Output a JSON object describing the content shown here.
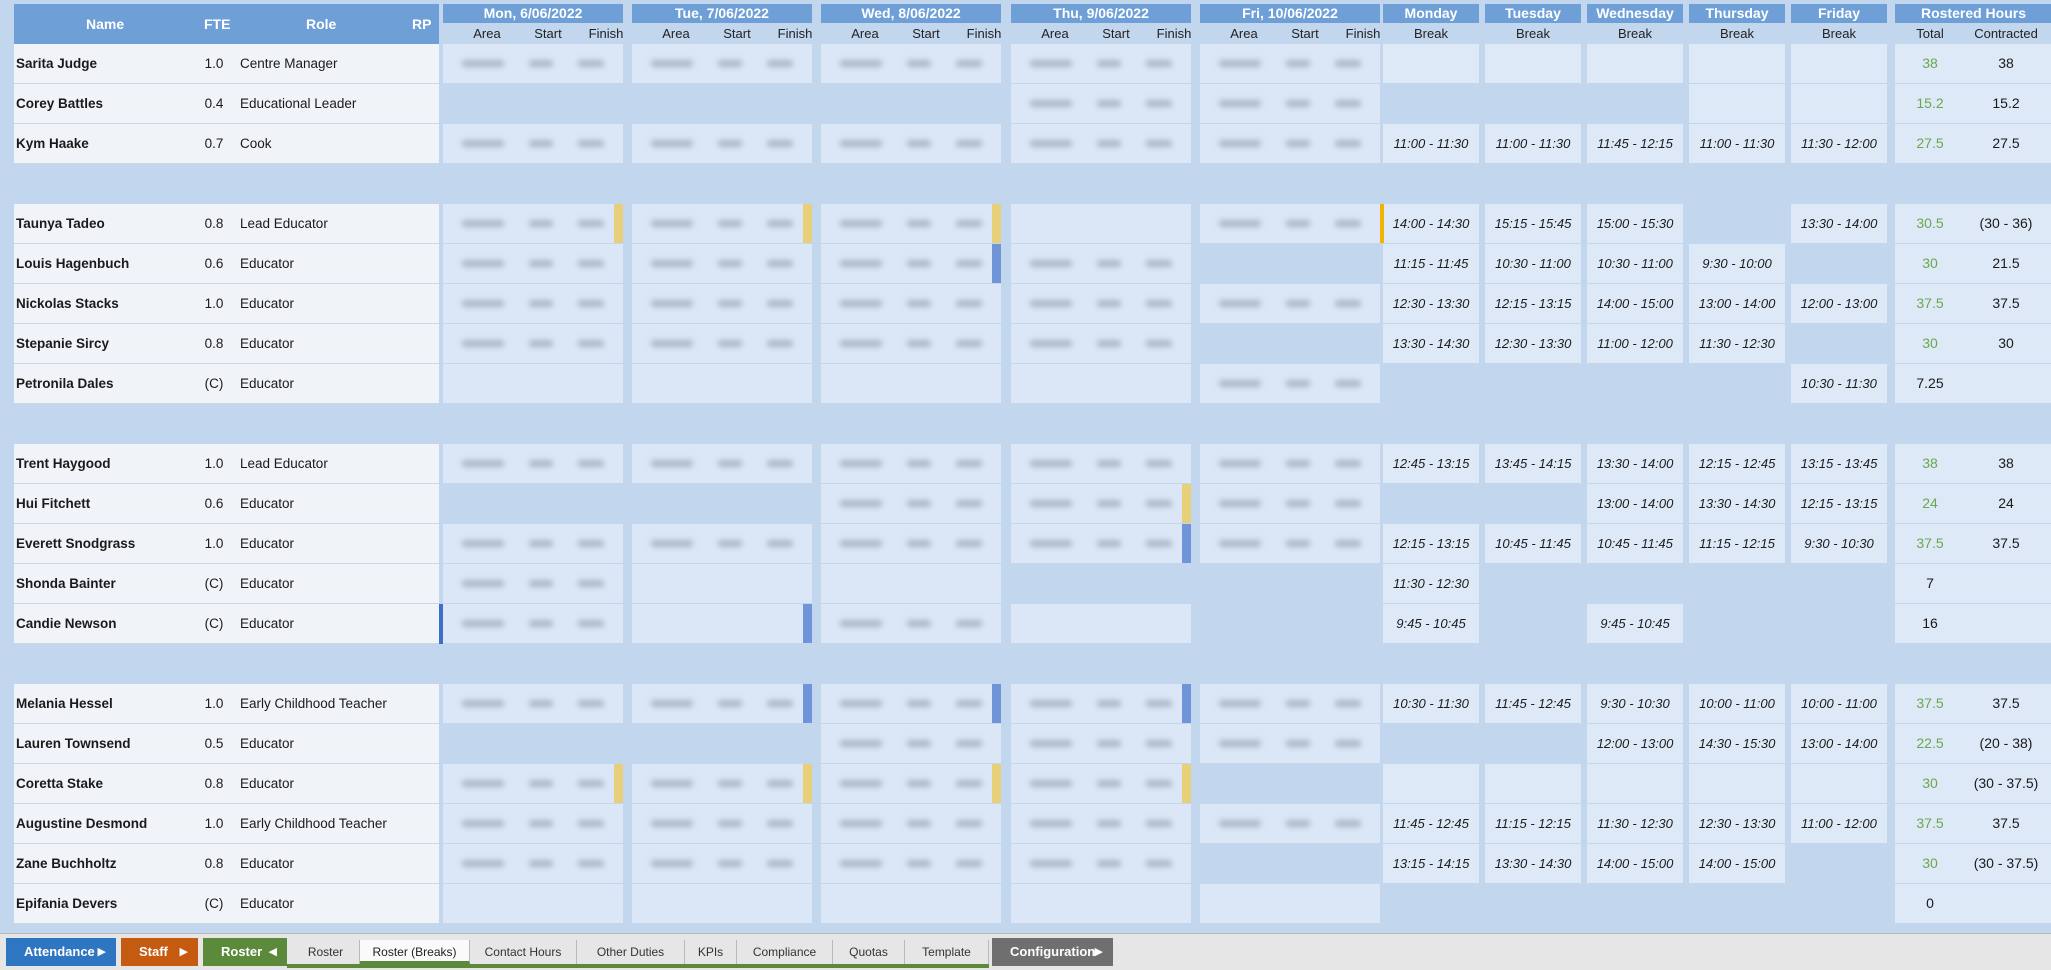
{
  "columns": {
    "name": "Name",
    "fte": "FTE",
    "role": "Role",
    "rp": "RP",
    "area": "Area",
    "start": "Start",
    "finish": "Finish",
    "break": "Break",
    "total": "Total",
    "contracted": "Contracted",
    "rostered_hours": "Rostered Hours"
  },
  "days": [
    "Mon, 6/06/2022",
    "Tue, 7/06/2022",
    "Wed, 8/06/2022",
    "Thu, 9/06/2022",
    "Fri, 10/06/2022"
  ],
  "break_days": [
    "Monday",
    "Tuesday",
    "Wednesday",
    "Thursday",
    "Friday"
  ],
  "staff": [
    {
      "name": "Sarita Judge",
      "fte": "1.0",
      "role": "Centre Manager",
      "shifts": [
        1,
        1,
        1,
        1,
        1
      ],
      "flags": [
        "",
        "",
        "",
        "",
        ""
      ],
      "breaks": [
        "",
        "",
        "",
        "",
        ""
      ],
      "total": "38",
      "contracted": "38",
      "green": true
    },
    {
      "name": "Corey Battles",
      "fte": "0.4",
      "role": "Educational Leader",
      "shifts": [
        0,
        0,
        0,
        1,
        1
      ],
      "flags": [
        "",
        "",
        "",
        "",
        ""
      ],
      "breaks": [
        null,
        null,
        null,
        "",
        ""
      ],
      "total": "15.2",
      "contracted": "15.2",
      "green": true
    },
    {
      "name": "Kym Haake",
      "fte": "0.7",
      "role": "Cook",
      "shifts": [
        1,
        1,
        1,
        1,
        1
      ],
      "flags": [
        "",
        "",
        "",
        "",
        ""
      ],
      "breaks": [
        "11:00  -  11:30",
        "11:00  -  11:30",
        "11:45  -  12:15",
        "11:00  -  11:30",
        "11:30  -  12:00"
      ],
      "total": "27.5",
      "contracted": "27.5",
      "green": true
    },
    {
      "spacer": true
    },
    {
      "name": "Taunya Tadeo",
      "fte": "0.8",
      "role": "Lead Educator",
      "shifts": [
        1,
        1,
        1,
        2,
        1
      ],
      "flags": [
        "#e8cf7a",
        "#e8cf7a",
        "#e8cf7a",
        "",
        ""
      ],
      "breaks": [
        "14:00  -  14:30",
        "15:15  -  15:45",
        "15:00  -  15:30",
        null,
        "13:30  -  14:00"
      ],
      "total": "30.5",
      "contracted": "(30 - 36)",
      "green": true,
      "mark": true
    },
    {
      "name": "Louis Hagenbuch",
      "fte": "0.6",
      "role": "Educator",
      "shifts": [
        1,
        1,
        1,
        1,
        0
      ],
      "flags": [
        "",
        "",
        "#6f95d8",
        "",
        ""
      ],
      "breaks": [
        "11:15  -  11:45",
        "10:30  -  11:00",
        "10:30  -  11:00",
        "9:30  -  10:00",
        null
      ],
      "total": "30",
      "contracted": "21.5",
      "green": true
    },
    {
      "name": "Nickolas Stacks",
      "fte": "1.0",
      "role": "Educator",
      "shifts": [
        1,
        1,
        1,
        1,
        1
      ],
      "flags": [
        "",
        "",
        "",
        "",
        ""
      ],
      "breaks": [
        "12:30  -  13:30",
        "12:15  -  13:15",
        "14:00  -  15:00",
        "13:00  -  14:00",
        "12:00  -  13:00"
      ],
      "total": "37.5",
      "contracted": "37.5",
      "green": true
    },
    {
      "name": "Stepanie Sircy",
      "fte": "0.8",
      "role": "Educator",
      "shifts": [
        1,
        1,
        1,
        1,
        0
      ],
      "flags": [
        "",
        "",
        "",
        "",
        ""
      ],
      "breaks": [
        "13:30  -  14:30",
        "12:30  -  13:30",
        "11:00  -  12:00",
        "11:30  -  12:30",
        null
      ],
      "total": "30",
      "contracted": "30",
      "green": true
    },
    {
      "name": "Petronila Dales",
      "fte": "(C)",
      "role": "Educator",
      "shifts": [
        2,
        2,
        2,
        2,
        1
      ],
      "flags": [
        "",
        "",
        "",
        "",
        ""
      ],
      "breaks": [
        null,
        null,
        null,
        null,
        "10:30  -  11:30"
      ],
      "total": "7.25",
      "contracted": "",
      "green": false
    },
    {
      "spacer": true
    },
    {
      "name": "Trent Haygood",
      "fte": "1.0",
      "role": "Lead Educator",
      "shifts": [
        1,
        1,
        1,
        1,
        1
      ],
      "flags": [
        "",
        "",
        "",
        "",
        ""
      ],
      "breaks": [
        "12:45  -  13:15",
        "13:45  -  14:15",
        "13:30  -  14:00",
        "12:15  -  12:45",
        "13:15  -  13:45"
      ],
      "total": "38",
      "contracted": "38",
      "green": true
    },
    {
      "name": "Hui Fitchett",
      "fte": "0.6",
      "role": "Educator",
      "shifts": [
        0,
        0,
        1,
        1,
        1
      ],
      "flags": [
        "",
        "",
        "",
        "#e8cf7a",
        ""
      ],
      "breaks": [
        null,
        null,
        "13:00  -  14:00",
        "13:30  -  14:30",
        "12:15  -  13:15"
      ],
      "total": "24",
      "contracted": "24",
      "green": true
    },
    {
      "name": "Everett Snodgrass",
      "fte": "1.0",
      "role": "Educator",
      "shifts": [
        1,
        1,
        1,
        1,
        1
      ],
      "flags": [
        "",
        "",
        "",
        "#6f95d8",
        ""
      ],
      "breaks": [
        "12:15  -  13:15",
        "10:45  -  11:45",
        "10:45  -  11:45",
        "11:15  -  12:15",
        "9:30  -  10:30"
      ],
      "total": "37.5",
      "contracted": "37.5",
      "green": true
    },
    {
      "name": "Shonda Bainter",
      "fte": "(C)",
      "role": "Educator",
      "shifts": [
        1,
        2,
        2,
        0,
        0
      ],
      "flags": [
        "",
        "",
        "",
        "",
        ""
      ],
      "breaks": [
        "11:30  -  12:30",
        null,
        null,
        null,
        null
      ],
      "total": "7",
      "contracted": "",
      "green": false
    },
    {
      "name": "Candie Newson",
      "fte": "(C)",
      "role": "Educator",
      "shifts": [
        1,
        2,
        1,
        2,
        0
      ],
      "flags": [
        "",
        "#6f95d8",
        "",
        "",
        ""
      ],
      "breaks": [
        "9:45  -  10:45",
        null,
        "9:45  -  10:45",
        null,
        null
      ],
      "total": "16",
      "contracted": "",
      "green": false,
      "leftmark": true
    },
    {
      "spacer": true
    },
    {
      "name": "Melania Hessel",
      "fte": "1.0",
      "role": "Early Childhood Teacher",
      "shifts": [
        1,
        1,
        1,
        1,
        1
      ],
      "flags": [
        "",
        "#6f95d8",
        "#6f95d8",
        "#6f95d8",
        ""
      ],
      "breaks": [
        "10:30  -  11:30",
        "11:45  -  12:45",
        "9:30  -  10:30",
        "10:00  -  11:00",
        "10:00  -  11:00"
      ],
      "total": "37.5",
      "contracted": "37.5",
      "green": true
    },
    {
      "name": "Lauren Townsend",
      "fte": "0.5",
      "role": "Educator",
      "shifts": [
        0,
        0,
        1,
        1,
        1
      ],
      "flags": [
        "",
        "",
        "",
        "",
        ""
      ],
      "breaks": [
        null,
        null,
        "12:00  -  13:00",
        "14:30  -  15:30",
        "13:00  -  14:00"
      ],
      "total": "22.5",
      "contracted": "(20 - 38)",
      "green": true
    },
    {
      "name": "Coretta Stake",
      "fte": "0.8",
      "role": "Educator",
      "shifts": [
        1,
        1,
        1,
        1,
        0
      ],
      "flags": [
        "#e8cf7a",
        "#e8cf7a",
        "#e8cf7a",
        "#e8cf7a",
        ""
      ],
      "breaks": [
        "",
        "",
        "",
        "",
        ""
      ],
      "total": "30",
      "contracted": "(30 - 37.5)",
      "green": true
    },
    {
      "name": "Augustine Desmond",
      "fte": "1.0",
      "role": "Early Childhood Teacher",
      "shifts": [
        1,
        1,
        1,
        1,
        1
      ],
      "flags": [
        "",
        "",
        "",
        "",
        ""
      ],
      "breaks": [
        "11:45  -  12:45",
        "11:15  -  12:15",
        "11:30  -  12:30",
        "12:30  -  13:30",
        "11:00  -  12:00"
      ],
      "total": "37.5",
      "contracted": "37.5",
      "green": true
    },
    {
      "name": "Zane Buchholtz",
      "fte": "0.8",
      "role": "Educator",
      "shifts": [
        1,
        1,
        1,
        1,
        0
      ],
      "flags": [
        "",
        "",
        "",
        "",
        ""
      ],
      "breaks": [
        "13:15  -  14:15",
        "13:30  -  14:30",
        "14:00  -  15:00",
        "14:00  -  15:00",
        null
      ],
      "total": "30",
      "contracted": "(30 - 37.5)",
      "green": true
    },
    {
      "name": "Epifania Devers",
      "fte": "(C)",
      "role": "Educator",
      "shifts": [
        2,
        2,
        2,
        2,
        2
      ],
      "flags": [
        "",
        "",
        "",
        "",
        ""
      ],
      "breaks": [
        null,
        null,
        null,
        null,
        null
      ],
      "total": "0",
      "contracted": "",
      "green": false
    }
  ],
  "tabs": {
    "attendance": "Attendance",
    "staff": "Staff",
    "roster": "Roster",
    "configuration": "Configuration",
    "sheets": [
      "Roster",
      "Roster (Breaks)",
      "Contact Hours",
      "Other Duties",
      "KPIs",
      "Compliance",
      "Quotas",
      "Template"
    ],
    "active_sheet": "Roster (Breaks)"
  },
  "colors": {
    "header": "#6e9fd6",
    "attendance": "#2e75c2",
    "staff": "#c55a11",
    "roster": "#5a8a3a",
    "configuration": "#6f6f6f",
    "total_green": "#6aa84f"
  }
}
